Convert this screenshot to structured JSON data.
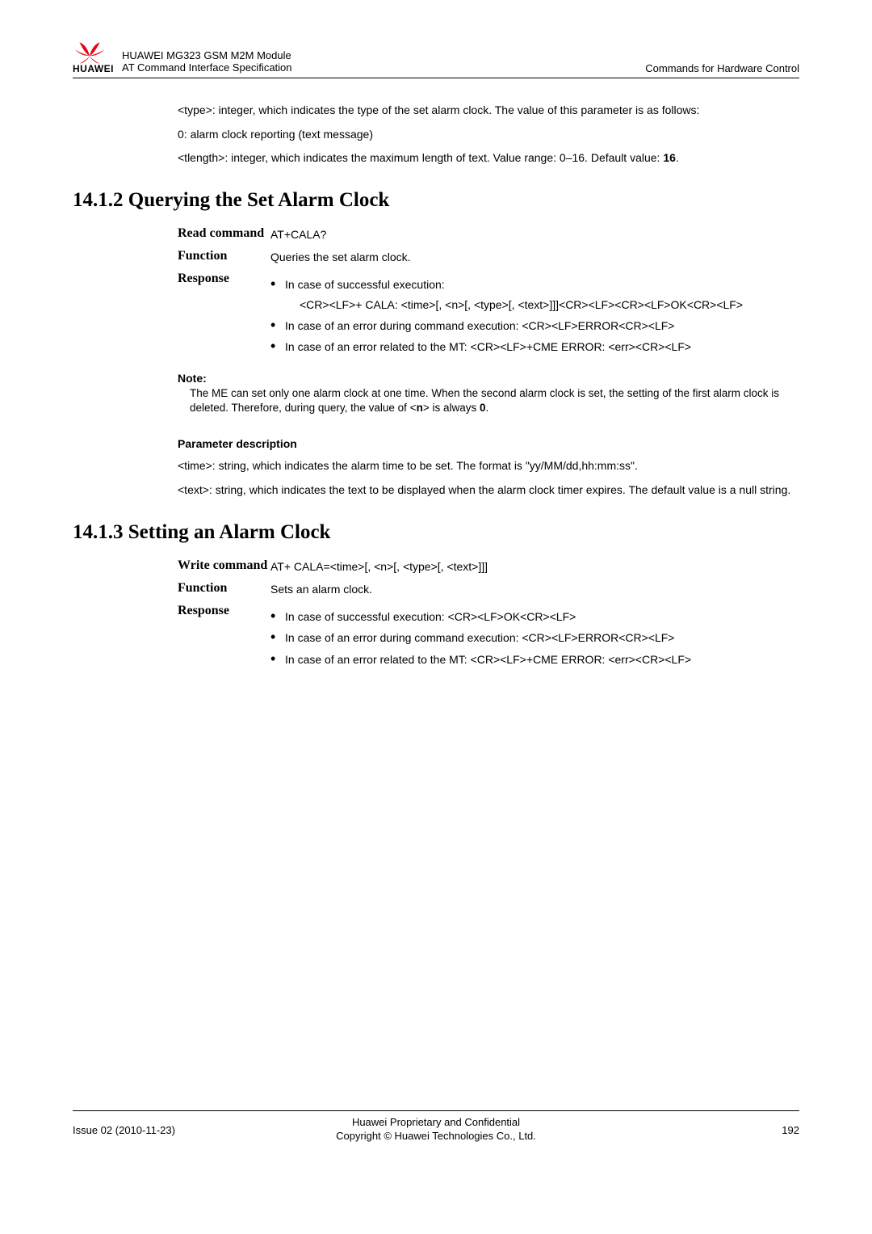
{
  "header": {
    "brand": "HUAWEI",
    "line1": "HUAWEI MG323 GSM M2M Module",
    "line2": "AT Command Interface Specification",
    "right": "Commands for Hardware Control"
  },
  "intro": {
    "p1": "<type>: integer, which indicates the type of the set alarm clock. The value of this parameter is as follows:",
    "p2": "0: alarm clock reporting (text message)",
    "p3a": "<tlength>: integer, which indicates the maximum length of text. Value range: 0–16. Default value: ",
    "p3b": "16",
    "p3c": "."
  },
  "sec1": {
    "title": "14.1.2 Querying the Set Alarm Clock",
    "readLabel": "Read command",
    "readVal": "AT+CALA?",
    "funcLabel": "Function",
    "funcVal": "Queries the set alarm clock.",
    "respLabel": "Response",
    "b1": "In case of successful execution:",
    "b1sub": "<CR><LF>+ CALA: <time>[, <n>[, <type>[, <text>]]]<CR><LF><CR><LF>OK<CR><LF>",
    "b2": "In case of an error during command execution: <CR><LF>ERROR<CR><LF>",
    "b3": "In case of an error related to the MT: <CR><LF>+CME ERROR: <err><CR><LF>"
  },
  "note": {
    "label": "Note:",
    "body1": "The ME can set only one alarm clock at one time. When the second alarm clock is set, the setting of the first alarm clock is deleted. Therefore, during query, the value of <",
    "body2": "n",
    "body3": "> is always ",
    "body4": "0",
    "body5": "."
  },
  "paramDesc": {
    "head": "Parameter description",
    "p1": "<time>: string, which indicates the alarm time to be set. The format is \"yy/MM/dd,hh:mm:ss\".",
    "p2": "<text>: string, which indicates the text to be displayed when the alarm clock timer expires. The default value is a null string."
  },
  "sec2": {
    "title": "14.1.3 Setting an Alarm Clock",
    "writeLabel": "Write command",
    "writeVal": "AT+ CALA=<time>[, <n>[, <type>[, <text>]]]",
    "funcLabel": "Function",
    "funcVal": "Sets an alarm clock.",
    "respLabel": "Response",
    "b1": "In case of successful execution: <CR><LF>OK<CR><LF>",
    "b2": "In case of an error during command execution: <CR><LF>ERROR<CR><LF>",
    "b3": "In case of an error related to the MT: <CR><LF>+CME ERROR: <err><CR><LF>"
  },
  "footer": {
    "left": "Issue 02 (2010-11-23)",
    "c1": "Huawei Proprietary and Confidential",
    "c2": "Copyright © Huawei Technologies Co., Ltd.",
    "right": "192"
  }
}
